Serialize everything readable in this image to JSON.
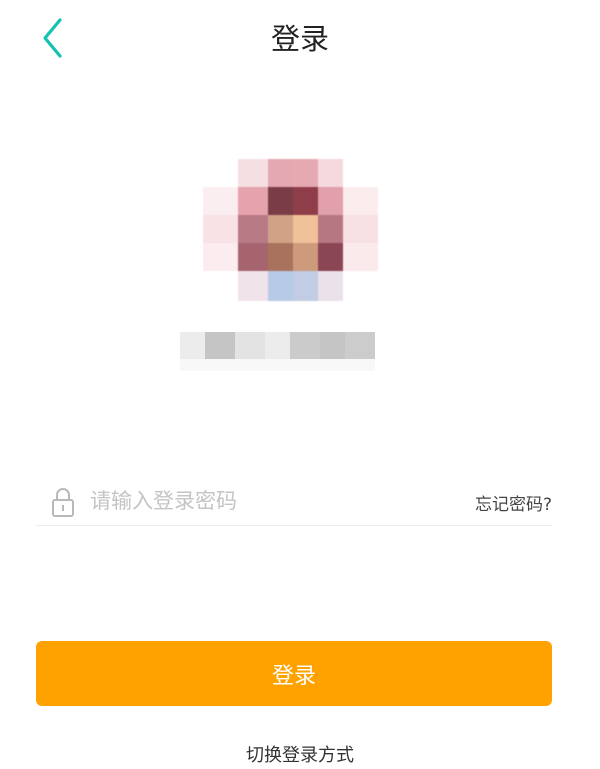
{
  "header": {
    "title": "登录",
    "back_icon": "chevron-left-icon",
    "accent_color": "#14c2b1"
  },
  "password": {
    "icon": "lock-icon",
    "placeholder": "请输入登录密码",
    "value": "",
    "forgot_label": "忘记密码?"
  },
  "login_button": {
    "label": "登录",
    "color": "#ffa200"
  },
  "switch_login_label": "切换登录方式"
}
